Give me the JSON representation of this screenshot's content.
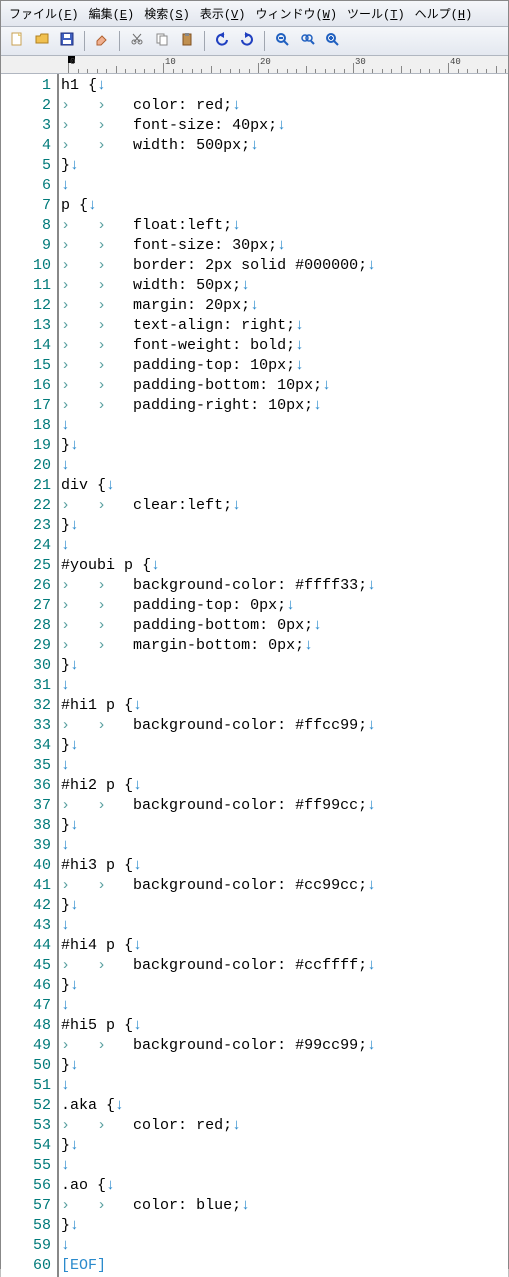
{
  "menubar": [
    {
      "label": "ファイル",
      "accel": "F"
    },
    {
      "label": "編集",
      "accel": "E"
    },
    {
      "label": "検索",
      "accel": "S"
    },
    {
      "label": "表示",
      "accel": "V"
    },
    {
      "label": "ウィンドウ",
      "accel": "W"
    },
    {
      "label": "ツール",
      "accel": "T"
    },
    {
      "label": "ヘルプ",
      "accel": "H"
    }
  ],
  "toolbar_icons": [
    "new-file",
    "open-file",
    "save",
    "sep",
    "erase",
    "sep",
    "cut",
    "copy",
    "paste",
    "sep",
    "undo",
    "redo",
    "sep",
    "zoom-out",
    "zoom-fit",
    "zoom-in"
  ],
  "ruler_marks": [
    "0",
    "10",
    "20",
    "30",
    "40"
  ],
  "line_count": 60,
  "code_lines": [
    {
      "indent": 0,
      "text": "h1 {"
    },
    {
      "indent": 2,
      "text": "color: red;"
    },
    {
      "indent": 2,
      "text": "font-size: 40px;"
    },
    {
      "indent": 2,
      "text": "width: 500px;"
    },
    {
      "indent": 0,
      "text": "}"
    },
    {
      "indent": 0,
      "text": ""
    },
    {
      "indent": 0,
      "text": "p {"
    },
    {
      "indent": 2,
      "text": "float:left;"
    },
    {
      "indent": 2,
      "text": "font-size: 30px;"
    },
    {
      "indent": 2,
      "text": "border: 2px solid #000000;"
    },
    {
      "indent": 2,
      "text": "width: 50px;"
    },
    {
      "indent": 2,
      "text": "margin: 20px;"
    },
    {
      "indent": 2,
      "text": "text-align: right;"
    },
    {
      "indent": 2,
      "text": "font-weight: bold;"
    },
    {
      "indent": 2,
      "text": "padding-top: 10px;"
    },
    {
      "indent": 2,
      "text": "padding-bottom: 10px;"
    },
    {
      "indent": 2,
      "text": "padding-right: 10px;"
    },
    {
      "indent": 0,
      "text": ""
    },
    {
      "indent": 0,
      "text": "}"
    },
    {
      "indent": 0,
      "text": ""
    },
    {
      "indent": 0,
      "text": "div {"
    },
    {
      "indent": 2,
      "text": "clear:left;"
    },
    {
      "indent": 0,
      "text": "}"
    },
    {
      "indent": 0,
      "text": ""
    },
    {
      "indent": 0,
      "text": "#youbi p {"
    },
    {
      "indent": 2,
      "text": "background-color: #ffff33;"
    },
    {
      "indent": 2,
      "text": "padding-top: 0px;"
    },
    {
      "indent": 2,
      "text": "padding-bottom: 0px;"
    },
    {
      "indent": 2,
      "text": "margin-bottom: 0px;"
    },
    {
      "indent": 0,
      "text": "}"
    },
    {
      "indent": 0,
      "text": ""
    },
    {
      "indent": 0,
      "text": "#hi1 p {"
    },
    {
      "indent": 2,
      "text": "background-color: #ffcc99;"
    },
    {
      "indent": 0,
      "text": "}"
    },
    {
      "indent": 0,
      "text": ""
    },
    {
      "indent": 0,
      "text": "#hi2 p {"
    },
    {
      "indent": 2,
      "text": "background-color: #ff99cc;"
    },
    {
      "indent": 0,
      "text": "}"
    },
    {
      "indent": 0,
      "text": ""
    },
    {
      "indent": 0,
      "text": "#hi3 p {"
    },
    {
      "indent": 2,
      "text": "background-color: #cc99cc;"
    },
    {
      "indent": 0,
      "text": "}"
    },
    {
      "indent": 0,
      "text": ""
    },
    {
      "indent": 0,
      "text": "#hi4 p {"
    },
    {
      "indent": 2,
      "text": "background-color: #ccffff;"
    },
    {
      "indent": 0,
      "text": "}"
    },
    {
      "indent": 0,
      "text": ""
    },
    {
      "indent": 0,
      "text": "#hi5 p {"
    },
    {
      "indent": 2,
      "text": "background-color: #99cc99;"
    },
    {
      "indent": 0,
      "text": "}"
    },
    {
      "indent": 0,
      "text": ""
    },
    {
      "indent": 0,
      "text": ".aka {"
    },
    {
      "indent": 2,
      "text": "color: red;"
    },
    {
      "indent": 0,
      "text": "}"
    },
    {
      "indent": 0,
      "text": ""
    },
    {
      "indent": 0,
      "text": ".ao {"
    },
    {
      "indent": 2,
      "text": "color: blue;"
    },
    {
      "indent": 0,
      "text": "}"
    },
    {
      "indent": 0,
      "text": ""
    }
  ],
  "eof_label": "[EOF]",
  "ws_dot": "·",
  "tab_mark": "›",
  "newline_mark": "↓",
  "colors": {
    "linenum": "#007a7a",
    "whitespace": "#5aa0a0",
    "newline": "#2a8acc"
  }
}
